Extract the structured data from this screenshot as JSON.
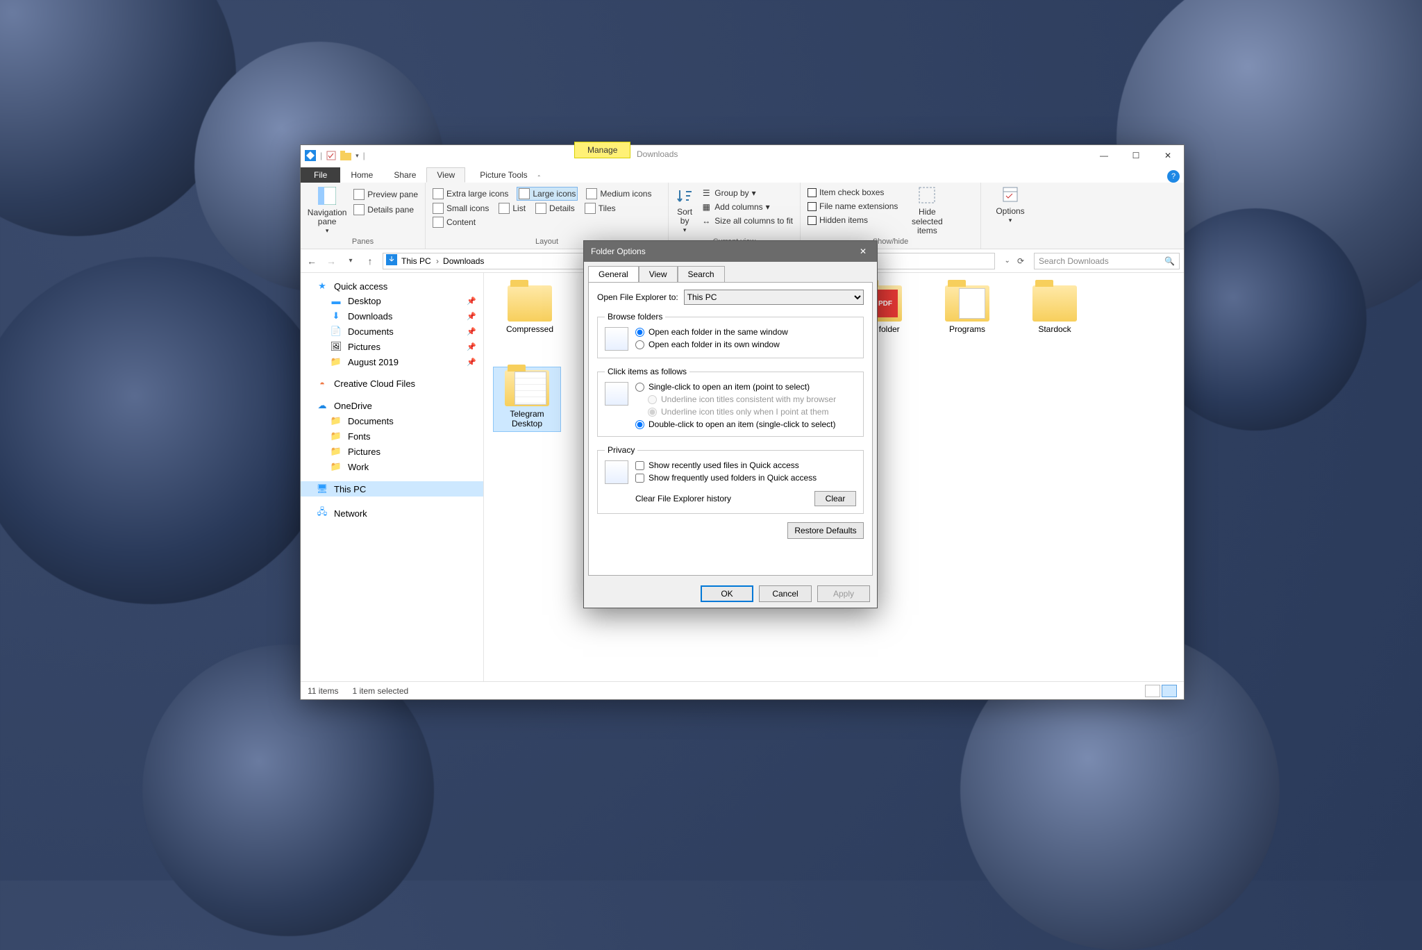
{
  "window": {
    "manage_label": "Manage",
    "context_title": "Downloads",
    "tabs": {
      "file": "File",
      "home": "Home",
      "share": "Share",
      "view": "View",
      "picture_tools": "Picture Tools"
    }
  },
  "ribbon": {
    "panes": {
      "navigation": "Navigation pane",
      "preview": "Preview pane",
      "details": "Details pane",
      "group": "Panes"
    },
    "layout": {
      "extra_large": "Extra large icons",
      "large": "Large icons",
      "medium": "Medium icons",
      "small": "Small icons",
      "list": "List",
      "details": "Details",
      "tiles": "Tiles",
      "content": "Content",
      "group": "Layout"
    },
    "view": {
      "sort_by": "Sort by",
      "group_by": "Group by",
      "add_columns": "Add columns",
      "size_fit": "Size all columns to fit",
      "group": "Current view"
    },
    "showhide": {
      "item_check": "Item check boxes",
      "file_ext": "File name extensions",
      "hidden": "Hidden items",
      "hide_selected": "Hide selected items",
      "group": "Show/hide"
    },
    "options": "Options"
  },
  "address": {
    "this_pc": "This PC",
    "downloads": "Downloads",
    "search_placeholder": "Search Downloads"
  },
  "nav": {
    "quick_access": "Quick access",
    "desktop": "Desktop",
    "downloads": "Downloads",
    "documents": "Documents",
    "pictures": "Pictures",
    "august": "August 2019",
    "creative_cloud": "Creative Cloud Files",
    "onedrive": "OneDrive",
    "od_documents": "Documents",
    "od_fonts": "Fonts",
    "od_pictures": "Pictures",
    "od_work": "Work",
    "this_pc": "This PC",
    "network": "Network"
  },
  "files": {
    "compressed": "Compressed",
    "telegram": "Telegram Desktop",
    "new_folder": "New folder",
    "programs": "Programs",
    "stardock": "Stardock"
  },
  "status": {
    "items": "11 items",
    "selected": "1 item selected"
  },
  "dialog": {
    "title": "Folder Options",
    "tabs": {
      "general": "General",
      "view": "View",
      "search": "Search"
    },
    "open_to_label": "Open File Explorer to:",
    "open_to_value": "This PC",
    "browse_legend": "Browse folders",
    "browse_same": "Open each folder in the same window",
    "browse_own": "Open each folder in its own window",
    "click_legend": "Click items as follows",
    "single_click": "Single-click to open an item (point to select)",
    "underline_browser": "Underline icon titles consistent with my browser",
    "underline_point": "Underline icon titles only when I point at them",
    "double_click": "Double-click to open an item (single-click to select)",
    "privacy_legend": "Privacy",
    "recent_files": "Show recently used files in Quick access",
    "frequent_folders": "Show frequently used folders in Quick access",
    "clear_history": "Clear File Explorer history",
    "clear_btn": "Clear",
    "restore_btn": "Restore Defaults",
    "ok": "OK",
    "cancel": "Cancel",
    "apply": "Apply"
  }
}
